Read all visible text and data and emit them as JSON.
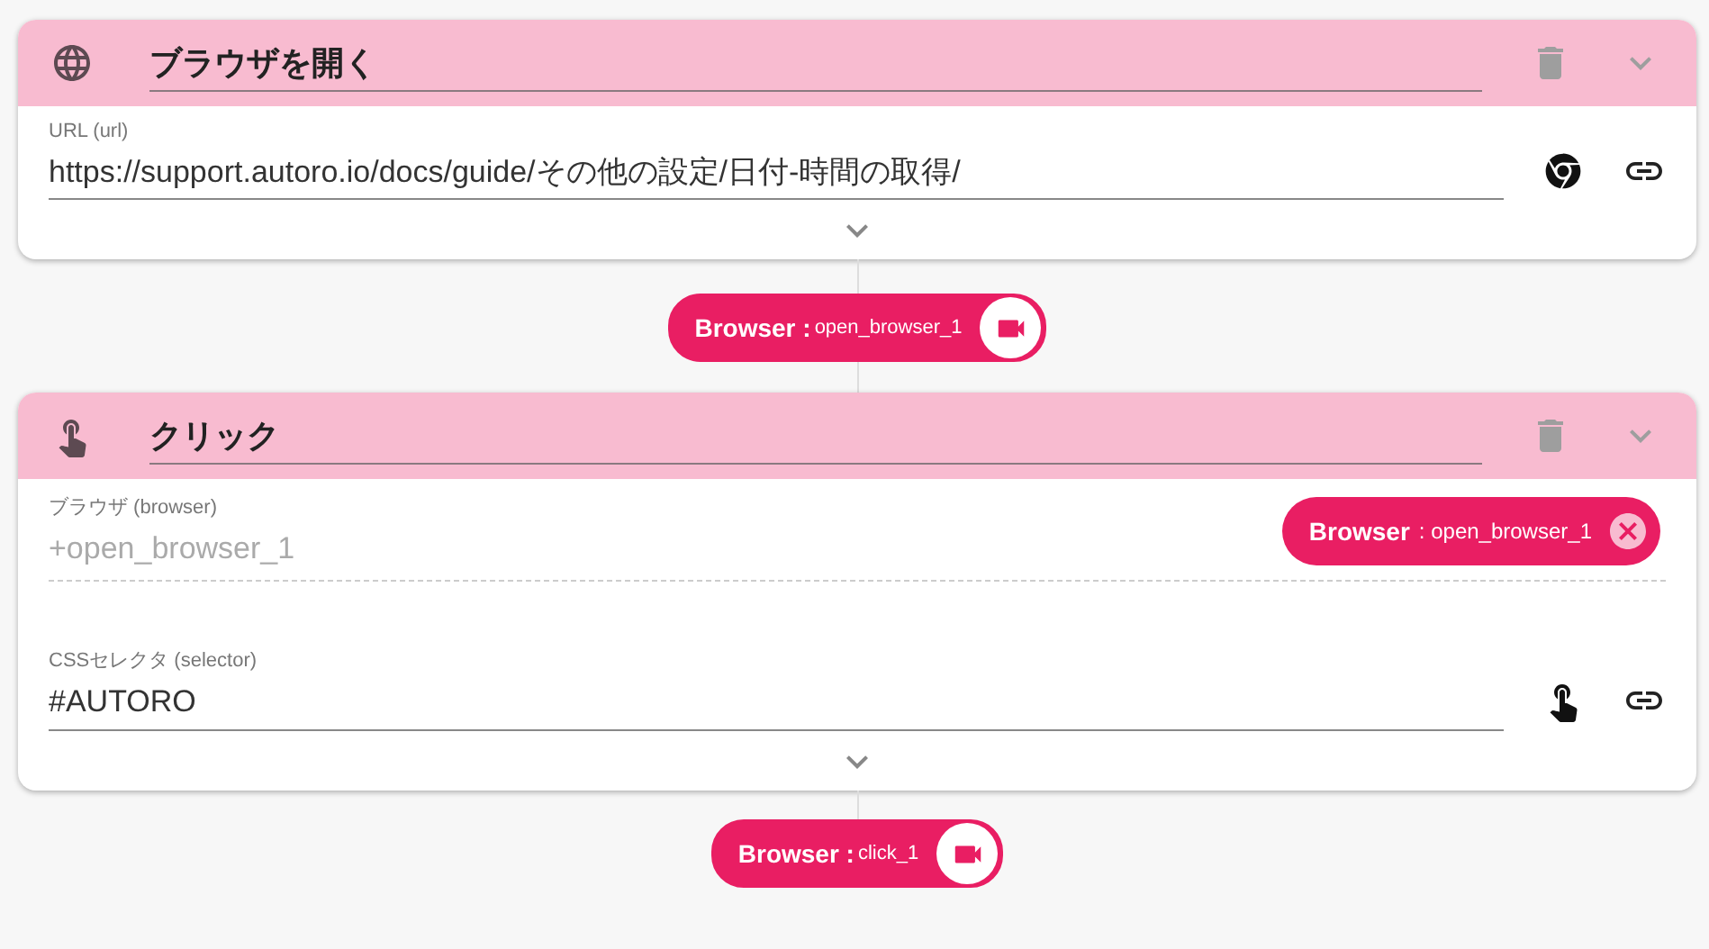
{
  "steps": [
    {
      "kind": "open",
      "title": "ブラウザを開く",
      "fields": [
        {
          "kind": "url",
          "label": "URL (url)",
          "value": "https://support.autoro.io/docs/guide/その他の設定/日付-時間の取得/"
        }
      ],
      "output": {
        "label": "Browser :",
        "name": "open_browser_1"
      }
    },
    {
      "kind": "click",
      "title": "クリック",
      "fields": [
        {
          "kind": "browser",
          "label": "ブラウザ (browser)",
          "placeholder": "+open_browser_1",
          "chip": {
            "label": "Browser",
            "name": ": open_browser_1"
          }
        },
        {
          "kind": "selector",
          "label": "CSSセレクタ (selector)",
          "value": "#AUTORO"
        }
      ],
      "output": {
        "label": "Browser :",
        "name": "click_1"
      }
    }
  ]
}
